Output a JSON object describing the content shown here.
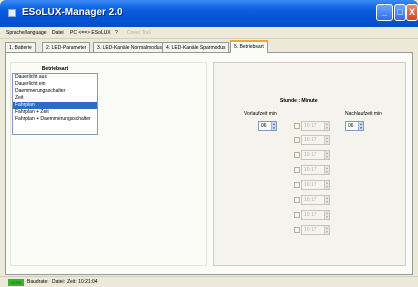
{
  "window": {
    "title": "ESoLUX-Manager 2.0"
  },
  "title_buttons": {
    "minimize": "_",
    "maximize": "□",
    "close": "X"
  },
  "menu": {
    "items": [
      "Sprache/language",
      "Datei",
      "PC <==> ESoLUX",
      "?",
      "Cover Tool"
    ]
  },
  "tabs": [
    "1. Batterie",
    "2. LED-Parameter",
    "3. LED-Kanäle Normalmodus",
    "4. LED-Kanäle Sparmodus",
    "5. Betriebsart"
  ],
  "active_tab": 4,
  "betriebsart": {
    "heading": "Betriebsart",
    "options": [
      "Dauerlicht aus",
      "Dauerlicht ein",
      "Daemmerungsschalter",
      "Zeit",
      "Fahrplan",
      "Fahrplan + Zeit",
      "Fahrplan + Daemmerungsschalter"
    ],
    "selected_index": 4
  },
  "schedule": {
    "heading": "Stunde : Minute",
    "vorlauf_label": "Vorlaufzeit min",
    "nachlauf_label": "Nachlaufzeit min",
    "vorlauf_value": "06",
    "nachlauf_value": "06",
    "time_rows": [
      "10:17",
      "10:17",
      "10:17",
      "10:17",
      "10:17",
      "10:17",
      "10:17",
      "10:17"
    ]
  },
  "status": {
    "com": "COM",
    "baudrate": "Baudrate:",
    "datei": "Datei:",
    "zeit": "Zeit: 10:21:04"
  }
}
